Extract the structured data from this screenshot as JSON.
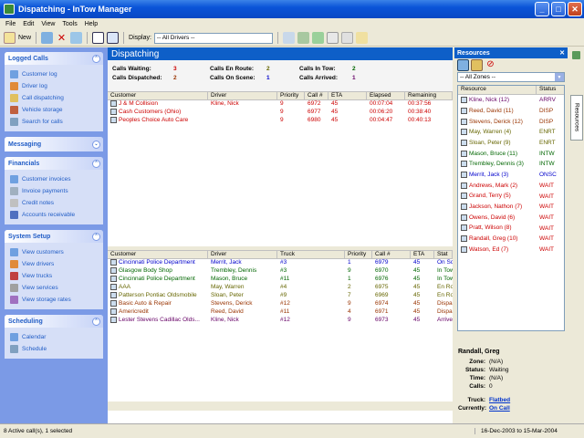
{
  "window": {
    "title": "Dispatching - InTow Manager"
  },
  "menu": [
    "File",
    "Edit",
    "View",
    "Tools",
    "Help"
  ],
  "toolbar": {
    "new_label": "New",
    "display_label": "Display:",
    "display_value": "-- All Drivers --"
  },
  "left": {
    "panels": [
      {
        "title": "Logged Calls",
        "items": [
          "Customer log",
          "Driver log",
          "Call dispatching",
          "Vehicle storage",
          "Search for calls"
        ]
      },
      {
        "title": "Messaging",
        "items": []
      },
      {
        "title": "Financials",
        "items": [
          "Customer invoices",
          "Invoice payments",
          "Credit notes",
          "Accounts receivable"
        ]
      },
      {
        "title": "System Setup",
        "items": [
          "View customers",
          "View drivers",
          "View trucks",
          "View services",
          "View storage rates"
        ]
      },
      {
        "title": "Scheduling",
        "items": [
          "Calendar",
          "Schedule"
        ]
      }
    ]
  },
  "dispatch": {
    "title": "Dispatching",
    "stats": [
      {
        "label": "Calls Waiting:",
        "value": "3"
      },
      {
        "label": "Calls Dispatched:",
        "value": "2"
      },
      {
        "label": "Calls En Route:",
        "value": "2"
      },
      {
        "label": "Calls On Scene:",
        "value": "1"
      },
      {
        "label": "Calls In Tow:",
        "value": "2"
      },
      {
        "label": "Calls Arrived:",
        "value": "1"
      }
    ],
    "top_columns": [
      "Customer",
      "Driver",
      "Priority",
      "Call #",
      "ETA",
      "Elapsed",
      "Remaining"
    ],
    "top_rows": [
      {
        "customer": "J & M Collision",
        "driver": "Kline, Nick",
        "priority": "9",
        "call": "6972",
        "eta": "45",
        "elapsed": "00:07:04",
        "remaining": "00:37:56"
      },
      {
        "customer": "Cash Customers (Ohio)",
        "driver": "",
        "priority": "9",
        "call": "6977",
        "eta": "45",
        "elapsed": "00:06:20",
        "remaining": "00:38:40"
      },
      {
        "customer": "Peoples Choice Auto Care",
        "driver": "",
        "priority": "9",
        "call": "6980",
        "eta": "45",
        "elapsed": "00:04:47",
        "remaining": "00:40:13"
      }
    ],
    "bottom_columns": [
      "Customer",
      "Driver",
      "Truck",
      "Priority",
      "Call #",
      "ETA",
      "Stat"
    ],
    "bottom_rows": [
      {
        "customer": "Cincinnati Police Department",
        "driver": "Merrit, Jack",
        "truck": "#3",
        "priority": "1",
        "call": "6979",
        "eta": "45",
        "stat": "On Sc",
        "color": "#0000cc"
      },
      {
        "customer": "Glasgow Body Shop",
        "driver": "Trembley, Dennis",
        "truck": "#3",
        "priority": "9",
        "call": "6970",
        "eta": "45",
        "stat": "In Tow",
        "color": "#006600"
      },
      {
        "customer": "Cincinnati Police Department",
        "driver": "Mason, Bruce",
        "truck": "#11",
        "priority": "1",
        "call": "6976",
        "eta": "45",
        "stat": "In Tow",
        "color": "#006600"
      },
      {
        "customer": "AAA",
        "driver": "May, Warren",
        "truck": "#4",
        "priority": "2",
        "call": "6975",
        "eta": "45",
        "stat": "En Ro",
        "color": "#666600"
      },
      {
        "customer": "Patterson Pontiac Oldsmobile",
        "driver": "Sloan, Peter",
        "truck": "#9",
        "priority": "7",
        "call": "6969",
        "eta": "45",
        "stat": "En Ro",
        "color": "#666600"
      },
      {
        "customer": "Basic Auto & Repair",
        "driver": "Stevens, Derick",
        "truck": "#12",
        "priority": "9",
        "call": "6974",
        "eta": "45",
        "stat": "Dispa",
        "color": "#993300"
      },
      {
        "customer": "Americredit",
        "driver": "Reed, David",
        "truck": "#11",
        "priority": "4",
        "call": "6971",
        "eta": "45",
        "stat": "Dispa",
        "color": "#993300"
      },
      {
        "customer": "Lester Stevens Cadillac Olds...",
        "driver": "Kline, Nick",
        "truck": "#12",
        "priority": "9",
        "call": "6973",
        "eta": "45",
        "stat": "Arrive",
        "color": "#660066"
      }
    ]
  },
  "resources": {
    "title": "Resources",
    "zone": "-- All Zones --",
    "columns": [
      "Resource",
      "Status"
    ],
    "rows": [
      {
        "name": "Kline, Nick (12)",
        "status": "ARRV",
        "color": "#660066"
      },
      {
        "name": "Reed, David (11)",
        "status": "DISP",
        "color": "#993300"
      },
      {
        "name": "Stevens, Derick (12)",
        "status": "DISP",
        "color": "#993300"
      },
      {
        "name": "May, Warren (4)",
        "status": "ENRT",
        "color": "#666600"
      },
      {
        "name": "Sloan, Peter (9)",
        "status": "ENRT",
        "color": "#666600"
      },
      {
        "name": "Mason, Bruce (11)",
        "status": "INTW",
        "color": "#006600"
      },
      {
        "name": "Trembley, Dennis (3)",
        "status": "INTW",
        "color": "#006600"
      },
      {
        "name": "Merrit, Jack (3)",
        "status": "ONSC",
        "color": "#0000cc"
      },
      {
        "name": "Andrews, Mark (2)",
        "status": "WAIT",
        "color": "#cc0000"
      },
      {
        "name": "Grand, Terry (5)",
        "status": "WAIT",
        "color": "#cc0000"
      },
      {
        "name": "Jackson, Nathon (7)",
        "status": "WAIT",
        "color": "#cc0000"
      },
      {
        "name": "Owens, David (6)",
        "status": "WAIT",
        "color": "#cc0000"
      },
      {
        "name": "Pratt, Wilson (8)",
        "status": "WAIT",
        "color": "#cc0000"
      },
      {
        "name": "Randall, Greg (10)",
        "status": "WAIT",
        "color": "#cc0000"
      },
      {
        "name": "Watson, Ed (7)",
        "status": "WAIT",
        "color": "#cc0000"
      }
    ],
    "detail": {
      "name": "Randall, Greg",
      "zone_label": "Zone:",
      "zone": "(N/A)",
      "status_label": "Status:",
      "status": "Waiting",
      "time_label": "Time:",
      "time": "(N/A)",
      "calls_label": "Calls:",
      "calls": "0",
      "truck_label": "Truck:",
      "truck": "Flatbed",
      "currently_label": "Currently:",
      "currently": "On Call"
    },
    "tab_label": "Resources"
  },
  "status": {
    "left": "8 Active call(s), 1 selected",
    "right": "16-Dec-2003 to 15-Mar-2004"
  }
}
